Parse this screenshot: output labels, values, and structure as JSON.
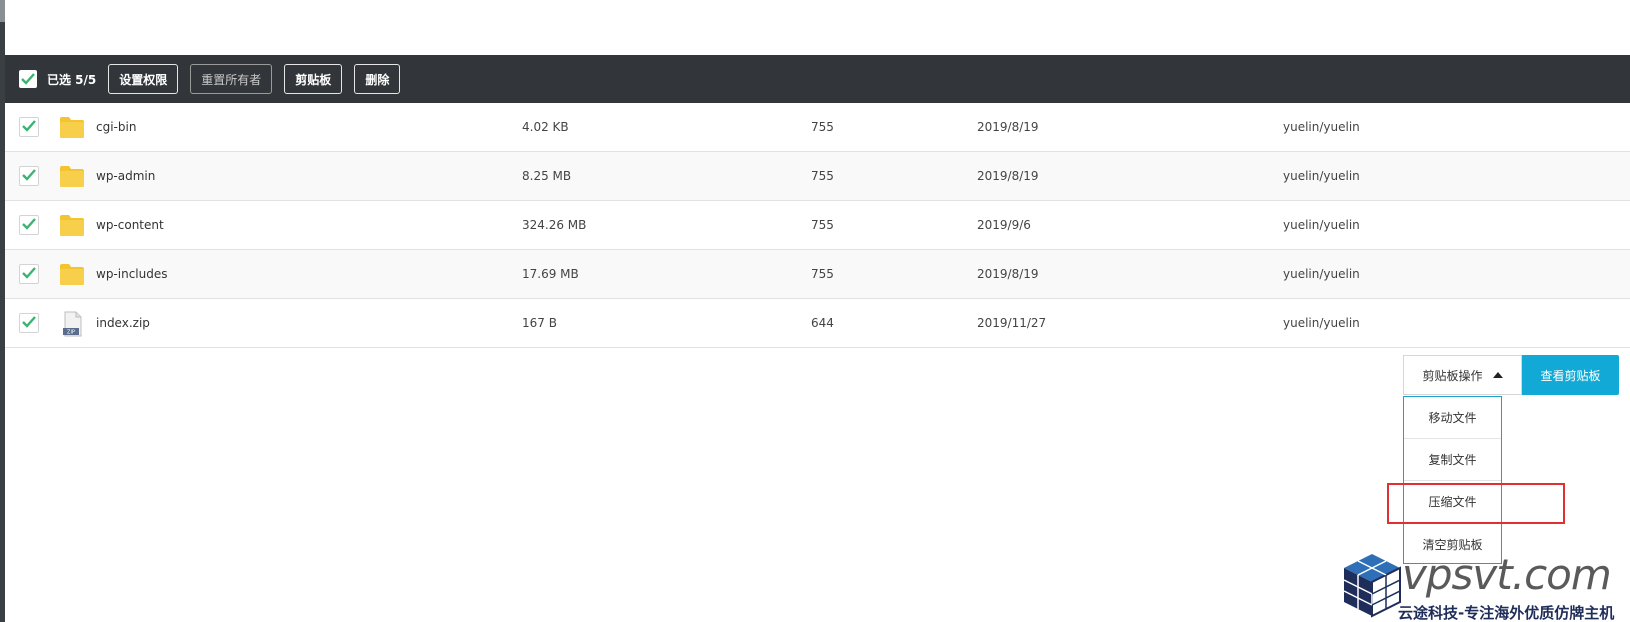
{
  "toolbar": {
    "selected_label": "已选 5/5",
    "buttons": [
      {
        "label": "设置权限",
        "disabled": false
      },
      {
        "label": "重置所有者",
        "disabled": true
      },
      {
        "label": "剪贴板",
        "disabled": false
      },
      {
        "label": "删除",
        "disabled": false
      }
    ]
  },
  "files": [
    {
      "name": "cgi-bin",
      "type": "folder",
      "size": "4.02 KB",
      "perm": "755",
      "date": "2019/8/19",
      "owner": "yuelin/yuelin",
      "checked": true
    },
    {
      "name": "wp-admin",
      "type": "folder",
      "size": "8.25 MB",
      "perm": "755",
      "date": "2019/8/19",
      "owner": "yuelin/yuelin",
      "checked": true
    },
    {
      "name": "wp-content",
      "type": "folder",
      "size": "324.26 MB",
      "perm": "755",
      "date": "2019/9/6",
      "owner": "yuelin/yuelin",
      "checked": true
    },
    {
      "name": "wp-includes",
      "type": "folder",
      "size": "17.69 MB",
      "perm": "755",
      "date": "2019/8/19",
      "owner": "yuelin/yuelin",
      "checked": true
    },
    {
      "name": "index.zip",
      "type": "zip",
      "size": "167 B",
      "perm": "644",
      "date": "2019/11/27",
      "owner": "yuelin/yuelin",
      "checked": true
    }
  ],
  "clipboard": {
    "dropdown_label": "剪贴板操作",
    "view_label": "查看剪贴板",
    "menu": [
      "移动文件",
      "复制文件",
      "压缩文件",
      "清空剪贴板"
    ]
  },
  "watermark": {
    "text": "vpsvt.com",
    "subtitle": "云途科技-专注海外优质仿牌主机"
  },
  "colors": {
    "toolbar_bg": "#32363a",
    "accent": "#13a9d6",
    "check": "#3cb371",
    "highlight": "#e03131",
    "folder": "#f4c430"
  }
}
